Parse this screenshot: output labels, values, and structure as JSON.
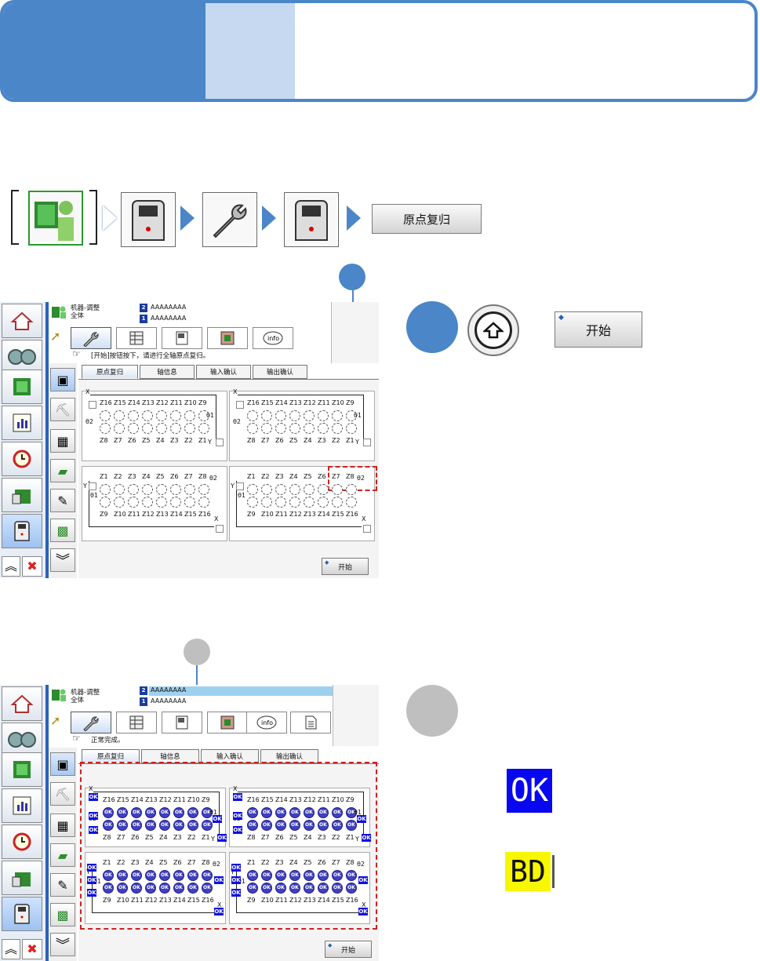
{
  "header": {
    "accent": "#4a86c8",
    "accent_light": "#c6d9f1"
  },
  "breadcrumb": {
    "icons": [
      "robot-operator-icon",
      "machine-icon",
      "wrench-icon",
      "machine-icon"
    ],
    "button_label": "原点复归"
  },
  "step_markers": {
    "top": "",
    "bottom": ""
  },
  "step1": {
    "key_icon": "shift-up-icon",
    "start_label": "开始"
  },
  "step2": {
    "ok_label": "OK",
    "bd_label": "BD"
  },
  "screen1": {
    "title_line1": "机器-调整",
    "title_line2": "全体",
    "slot2": "AAAAAAAA",
    "slot1": "AAAAAAAA",
    "message": "[开始]按钮按下，请进行全轴原点复归。",
    "tabs": [
      "原点复归",
      "轴信息",
      "输入确认",
      "输出确认"
    ],
    "start_button": "开始"
  },
  "screen2": {
    "title_line1": "机器-调整",
    "title_line2": "全体",
    "slot2": "AAAAAAAA",
    "slot1": "AAAAAAAA",
    "message": "正常完成。",
    "tabs": [
      "原点复归",
      "轴信息",
      "输入确认",
      "输出确认"
    ],
    "start_button": "开始"
  },
  "panels": {
    "x_label": "X",
    "y_label": "Y",
    "theta1": "θ1",
    "theta2": "θ2",
    "ok": "OK",
    "top_row_upper": [
      "Z16",
      "Z15",
      "Z14",
      "Z13",
      "Z12",
      "Z11",
      "Z10",
      "Z9"
    ],
    "top_row_lower": [
      "Z8",
      "Z7",
      "Z6",
      "Z5",
      "Z4",
      "Z3",
      "Z2",
      "Z1"
    ],
    "bottom_row_upper": [
      "Z1",
      "Z2",
      "Z3",
      "Z4",
      "Z5",
      "Z6",
      "Z7",
      "Z8"
    ],
    "bottom_row_lower": [
      "Z9",
      "Z10",
      "Z11",
      "Z12",
      "Z13",
      "Z14",
      "Z15",
      "Z16"
    ]
  }
}
